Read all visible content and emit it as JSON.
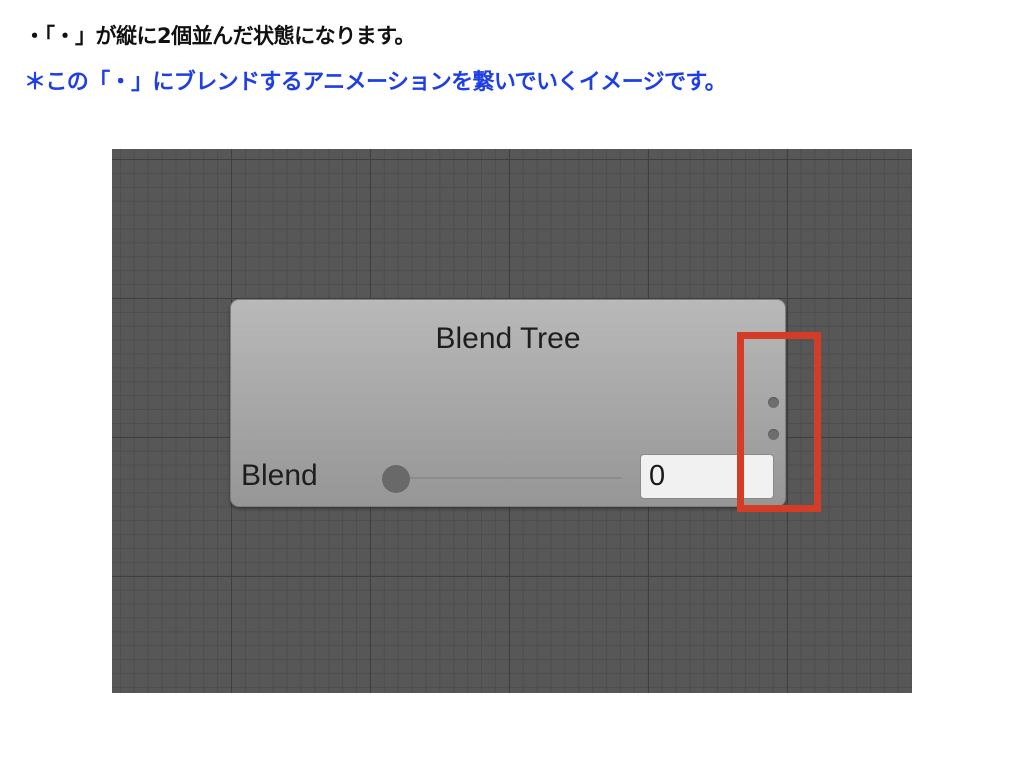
{
  "captions": {
    "line1": "・「・」が縦に2個並んだ状態になります。",
    "line2": "＊この「・」にブレンドするアニメーションを繋いでいくイメージです。"
  },
  "colors": {
    "caption_primary": "#111111",
    "caption_accent": "#1f3fe6",
    "graph_background": "#575757",
    "highlight": "#d33c27"
  },
  "node": {
    "title": "Blend Tree",
    "output_port_count": 2,
    "parameter": {
      "label": "Blend",
      "value": "0",
      "slider_fraction": 0.0
    }
  }
}
